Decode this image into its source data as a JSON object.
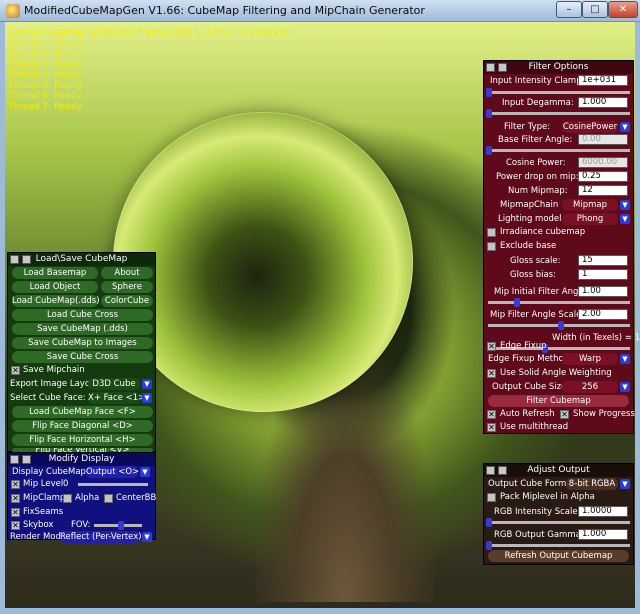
{
  "window": {
    "title": "ModifiedCubeMapGen V1.66: CubeMap Filtering and MipChain Generator",
    "min": "–",
    "max": "□",
    "close": "✕"
  },
  "status": {
    "lines": [
      "Output Cubemap (256x256) Frame 1689 (...) FPS (...) 256x256",
      "Thread 1: Ready",
      "Thread 2: Ready",
      "Thread 3: Ready",
      "Thread 4: Ready",
      "Thread 5: Ready",
      "Thread 6: Ready",
      "Thread 7: Ready"
    ]
  },
  "load_save": {
    "title": "Load\\Save CubeMap",
    "load_basemap": "Load Basemap",
    "about": "About",
    "load_object": "Load Object",
    "sphere": "Sphere",
    "load_cubemap_dds": "Load CubeMap(.dds)",
    "colorcube": "ColorCube",
    "load_cube_cross": "Load Cube Cross",
    "save_cubemap_dds": "Save CubeMap (.dds)",
    "save_cubemap_images": "Save CubeMap to Images",
    "save_cube_cross": "Save Cube Cross",
    "save_mipchain": "Save Mipchain",
    "export_layout_label": "Export Image Layout:",
    "export_layout_value": "D3D Cube",
    "select_face_label": "Select Cube Face:",
    "select_face_value": "X+ Face <1>",
    "load_cubemap_face": "Load CubeMap Face  <F>",
    "flip_diagonal": "Flip Face Diagonal  <D>",
    "flip_horizontal": "Flip Face Horizontal  <H>",
    "flip_vertical": "Flip Face Vertical  <V>"
  },
  "modify_display": {
    "title": "Modify Display",
    "display_cubemap_label": "Display CubeMap:",
    "display_cubemap_value": "Output <O>",
    "mip_level_label": "Mip Level",
    "mip_level_value": "0",
    "mipclamp": "MipClamp",
    "alpha": "Alpha",
    "centerbb": "CenterBB",
    "fixseams": "FixSeams",
    "skybox": "Skybox",
    "fov": "FOV:",
    "render_mode_label": "Render Mode",
    "render_mode_value": "Reflect (Per-Vertex)"
  },
  "filter_options": {
    "title": "Filter Options",
    "input_clamp_label": "Input Intensity Clamp:",
    "input_clamp_value": "1e+031",
    "input_degamma_label": "Input Degamma:",
    "input_degamma_value": "1.000",
    "filter_type_label": "Filter Type:",
    "filter_type_value": "CosinePower",
    "base_filter_angle_label": "Base Filter Angle:",
    "base_filter_angle_value": "0.00",
    "cosine_power_label": "Cosine Power:",
    "cosine_power_value": "6000.00",
    "power_drop_label": "Power drop on mip:",
    "power_drop_value": "0.25",
    "num_mipmap_label": "Num Mipmap:",
    "num_mipmap_value": "12",
    "mipmapchain_label": "MipmapChain",
    "mipmapchain_value": "Mipmap",
    "lighting_model_label": "Lighting model",
    "lighting_model_value": "Phong",
    "irradiance_cubemap": "Irradiance cubemap",
    "exclude_base": "Exclude base",
    "gloss_scale_label": "Gloss scale:",
    "gloss_scale_value": "15",
    "gloss_bias_label": "Gloss bias:",
    "gloss_bias_value": "1",
    "mip_initial_angle_label": "Mip Initial Filter Angle:",
    "mip_initial_angle_value": "1.00",
    "mip_angle_scale_label": "Mip Filter Angle Scale:",
    "mip_angle_scale_value": "2.00",
    "width_texels_label": "Width (in Texels) = 1",
    "edge_fixup": "Edge Fixup",
    "edge_fixup_method_label": "Edge Fixup Method",
    "edge_fixup_method_value": "Warp",
    "use_solid_angle": "Use Solid Angle Weighting",
    "output_cube_size_label": "Output Cube Size",
    "output_cube_size_value": "256",
    "filter_cubemap": "Filter Cubemap",
    "auto_refresh": "Auto Refresh",
    "show_progress": "Show Progress",
    "use_multithread": "Use multithread"
  },
  "adjust_output": {
    "title": "Adjust Output",
    "output_format_label": "Output Cube Format",
    "output_format_value": "8-bit RGBA",
    "pack_mip_alpha": "Pack Miplevel in Alpha",
    "rgb_scale_label": "RGB Intensity Scale:",
    "rgb_scale_value": "1.0000",
    "rgb_gamma_label": "RGB Output Gamma:",
    "rgb_gamma_value": "1.000",
    "refresh_output": "Refresh Output Cubemap"
  },
  "colors": {
    "load_panel": "#153a10",
    "modify_panel": "#10107e",
    "filter_panel": "#5e0a1a",
    "adjust_panel": "#2a1a14",
    "status_text": "#f2ea0a"
  }
}
